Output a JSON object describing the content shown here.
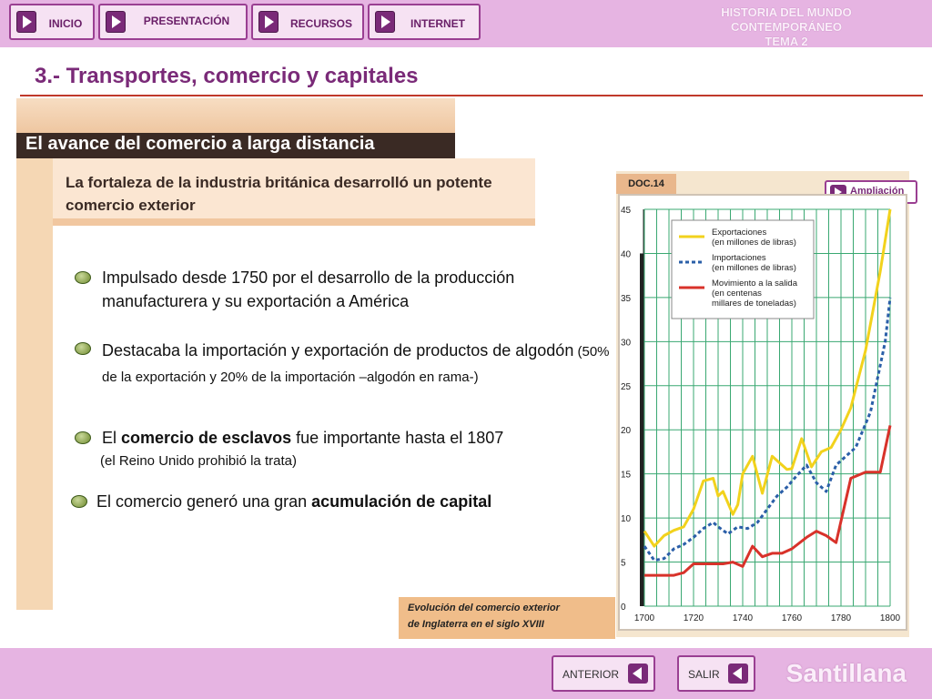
{
  "nav": {
    "items": [
      {
        "label": "INICIO"
      },
      {
        "label": "PRESENTACIÓN"
      },
      {
        "label": "RECURSOS"
      },
      {
        "label": "INTERNET"
      }
    ],
    "header_line1": "HISTORIA DEL MUNDO CONTEMPORÁNEO",
    "header_line2": "TEMA 2"
  },
  "section_title": "3.- Transportes, comercio y capitales",
  "banner_title": "El avance del comercio a larga distancia",
  "subtitle": "La fortaleza de la industria británica desarrolló un potente comercio exterior",
  "bullets": [
    {
      "text": "Impulsado desde 1750 por el desarrollo de la producción manufacturera y su exportación a América"
    },
    {
      "main": "Destacaba la importación y exportación de productos de algodón",
      "detail": " (50% de la exportación y 20% de la importación –algodón en rama-)"
    },
    {
      "pre": "El ",
      "bold": "comercio de esclavos",
      "post": " fue importante hasta el 1807",
      "note": "(el Reino Unido prohibió la trata)"
    },
    {
      "pre": "El comercio generó una gran ",
      "bold": "acumulación de capital",
      "post": ""
    }
  ],
  "doc_label": "DOC.14",
  "ampliacion_label": "Ampliación",
  "caption_line1": "Evolución del comercio exterior",
  "caption_line2": "de Inglaterra en el siglo XVIII",
  "footer": {
    "prev_label": "ANTERIOR",
    "exit_label": "SALIR",
    "brand": "Santillana"
  },
  "chart_data": {
    "type": "line",
    "title": "",
    "xlabel": "",
    "ylabel": "",
    "xlim": [
      1700,
      1800
    ],
    "ylim": [
      0,
      45
    ],
    "x_ticks": [
      1700,
      1720,
      1740,
      1760,
      1780,
      1800
    ],
    "y_ticks": [
      0,
      5,
      10,
      15,
      20,
      25,
      30,
      35,
      40,
      45
    ],
    "grid": true,
    "legend_position": "top-right",
    "colors": {
      "exports": "#f2d21c",
      "imports": "#2b5fa8",
      "shipping": "#d8322a",
      "grid": "#3aa872"
    },
    "series": [
      {
        "name": "Exportaciones (en millones de libras)",
        "style": "solid",
        "x": [
          1700,
          1704,
          1708,
          1712,
          1716,
          1720,
          1724,
          1728,
          1730,
          1732,
          1736,
          1738,
          1740,
          1744,
          1748,
          1752,
          1754,
          1758,
          1760,
          1764,
          1768,
          1772,
          1776,
          1780,
          1784,
          1790,
          1796,
          1800
        ],
        "values": [
          8.5,
          6.8,
          8.0,
          8.6,
          9.0,
          11.0,
          14.2,
          14.5,
          12.5,
          13.0,
          10.4,
          11.5,
          15.0,
          17.0,
          12.8,
          17.0,
          16.5,
          15.5,
          15.6,
          19.0,
          15.8,
          17.5,
          18.0,
          20.0,
          22.5,
          29.0,
          38.0,
          45.0
        ]
      },
      {
        "name": "Importaciones (en millones de libras)",
        "style": "dashed",
        "x": [
          1700,
          1704,
          1708,
          1712,
          1716,
          1720,
          1724,
          1728,
          1730,
          1734,
          1738,
          1742,
          1746,
          1750,
          1754,
          1758,
          1762,
          1766,
          1770,
          1774,
          1778,
          1782,
          1786,
          1792,
          1798,
          1800
        ],
        "values": [
          6.8,
          5.2,
          5.4,
          6.5,
          7.0,
          7.8,
          8.8,
          9.5,
          9.0,
          8.2,
          9.0,
          8.8,
          9.5,
          11.0,
          12.5,
          13.5,
          14.8,
          16.0,
          14.0,
          13.0,
          16.0,
          17.0,
          18.0,
          22.0,
          30.0,
          35.0
        ]
      },
      {
        "name": "Movimiento a la salida (en centenas de millares de toneladas)",
        "style": "solid",
        "x": [
          1700,
          1704,
          1708,
          1712,
          1716,
          1720,
          1724,
          1728,
          1732,
          1736,
          1740,
          1744,
          1748,
          1752,
          1756,
          1760,
          1766,
          1770,
          1774,
          1778,
          1784,
          1790,
          1796,
          1800
        ],
        "values": [
          3.5,
          3.5,
          3.5,
          3.5,
          3.8,
          4.8,
          4.8,
          4.8,
          4.8,
          5.0,
          4.5,
          6.8,
          5.6,
          6.0,
          6.0,
          6.5,
          7.8,
          8.5,
          8.0,
          7.2,
          14.5,
          15.2,
          15.2,
          20.5
        ]
      }
    ]
  }
}
